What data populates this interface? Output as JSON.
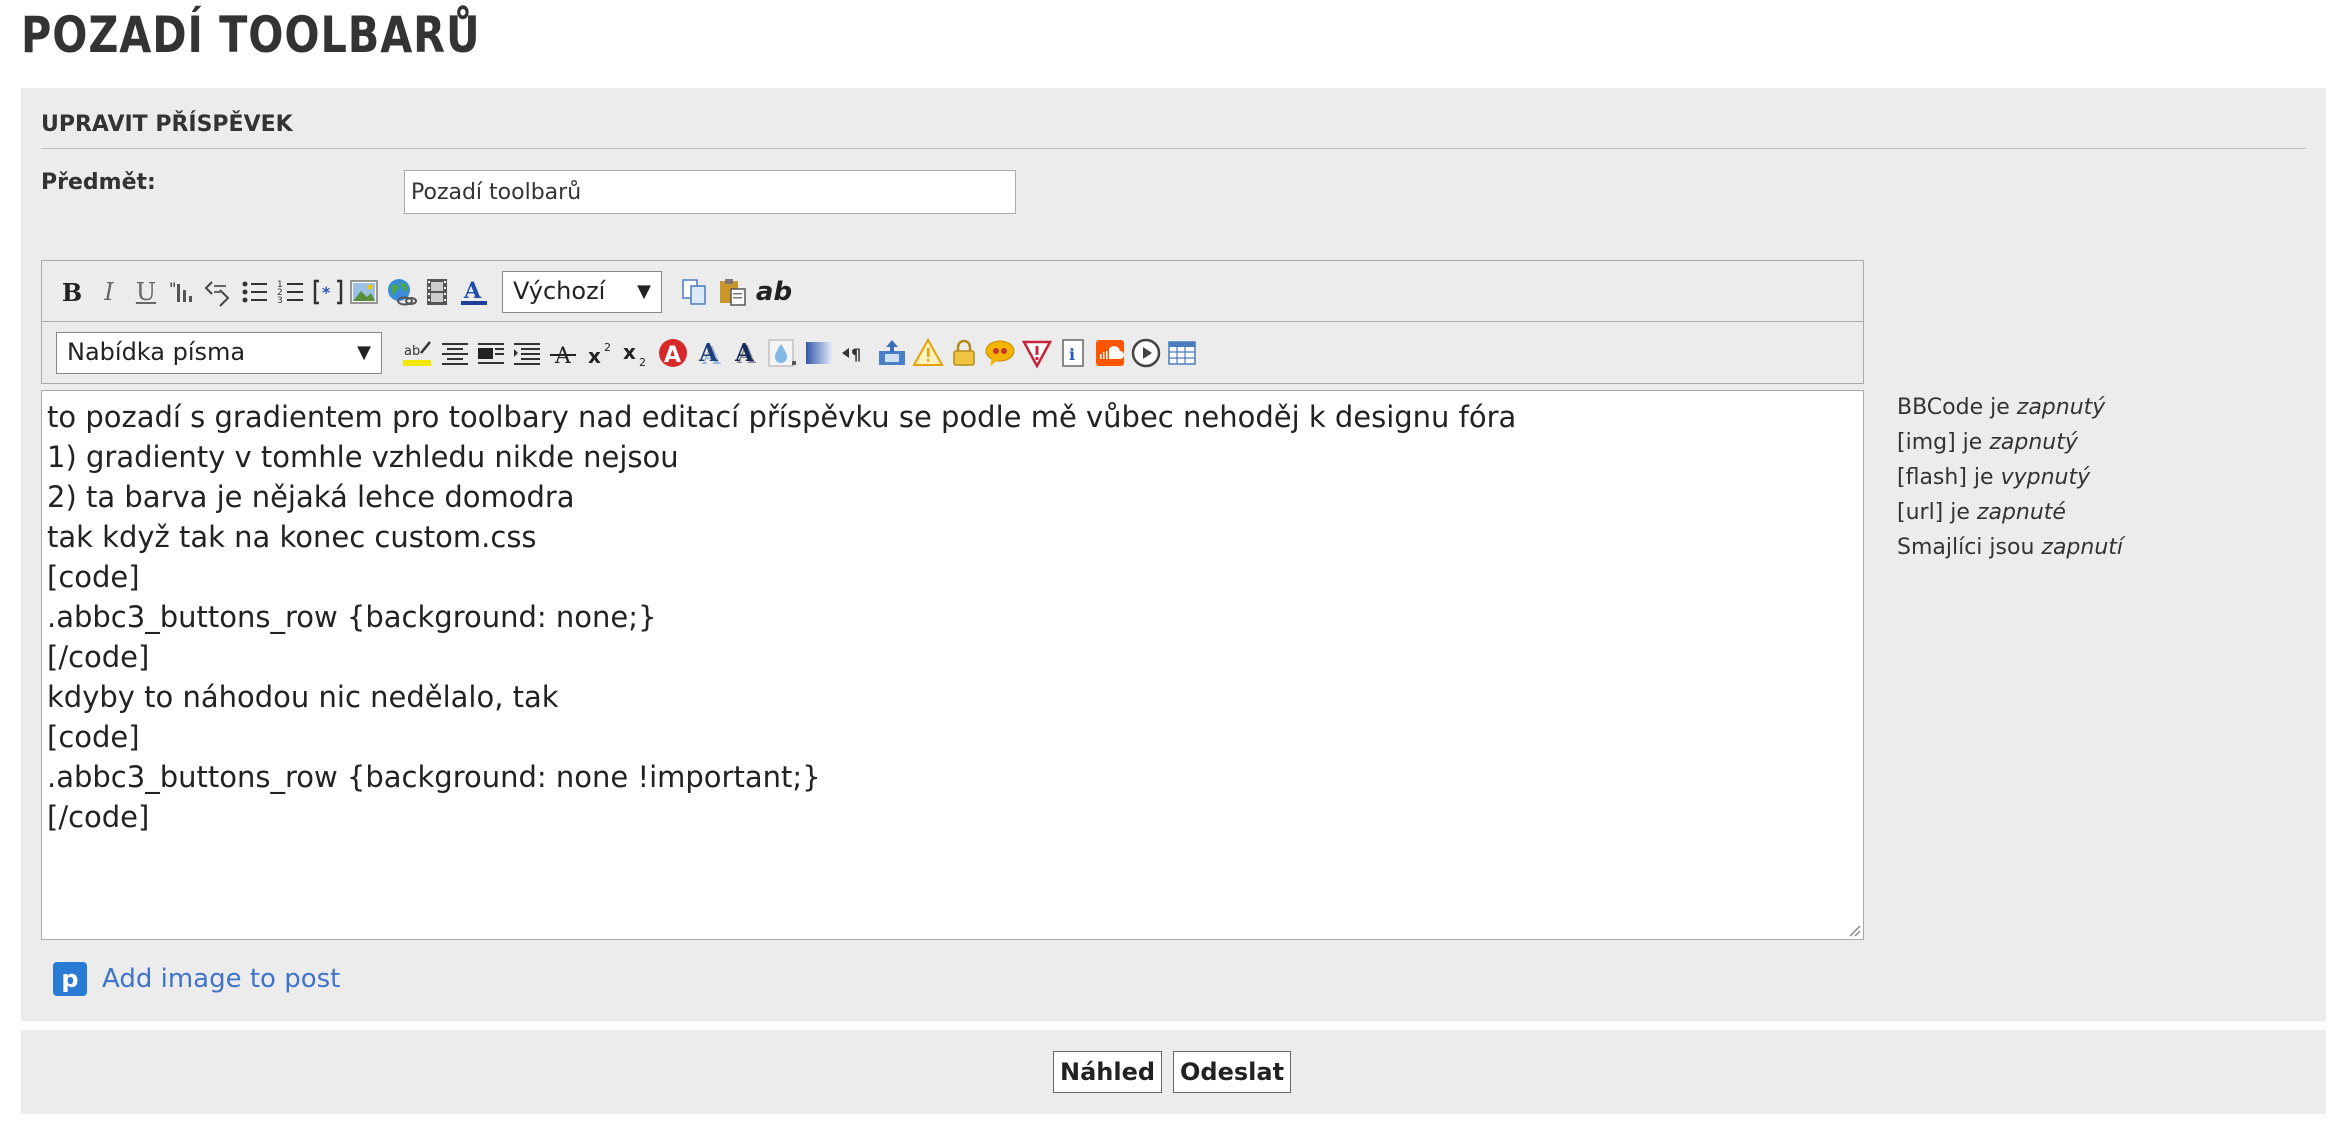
{
  "page_title": "POZADÍ TOOLBARŮ",
  "form": {
    "section_title": "UPRAVIT PŘÍSPĚVEK",
    "subject_label": "Předmět:",
    "subject_value": "Pozadí toolbarů"
  },
  "toolbar": {
    "row1": {
      "bold": "B",
      "italic": "I",
      "underline": "U",
      "spellcheck": "ab",
      "size_select": "Výchozí"
    },
    "row2": {
      "font_select": "Nabídka písma"
    }
  },
  "editor": {
    "lines": [
      "to pozadí s gradientem pro toolbary nad editací příspěvku se podle mě vůbec nehoděj k designu fóra",
      "1) gradienty v tomhle vzhledu nikde nejsou",
      "2) ta barva je nějaká lehce domodra",
      "tak když tak na konec custom.css",
      "[code]",
      ".abbc3_buttons_row {background: none;}",
      "[/code]",
      "kdyby to náhodou nic nedělalo, tak",
      "[code]",
      ".abbc3_buttons_row {background: none !important;}",
      "[/code]"
    ]
  },
  "status": {
    "bbcode": {
      "text": "BBCode je",
      "state": "zapnutý"
    },
    "img": {
      "text": "[img] je",
      "state": "zapnutý"
    },
    "flash": {
      "text": "[flash] je",
      "state": "vypnutý"
    },
    "url": {
      "text": "[url] je",
      "state": "zapnuté"
    },
    "smilies": {
      "text": "Smajlíci jsou",
      "state": "zapnutí"
    }
  },
  "add_image": {
    "label": "Add image to post",
    "icon": "p"
  },
  "buttons": {
    "preview": "Náhled",
    "submit": "Odeslat"
  }
}
